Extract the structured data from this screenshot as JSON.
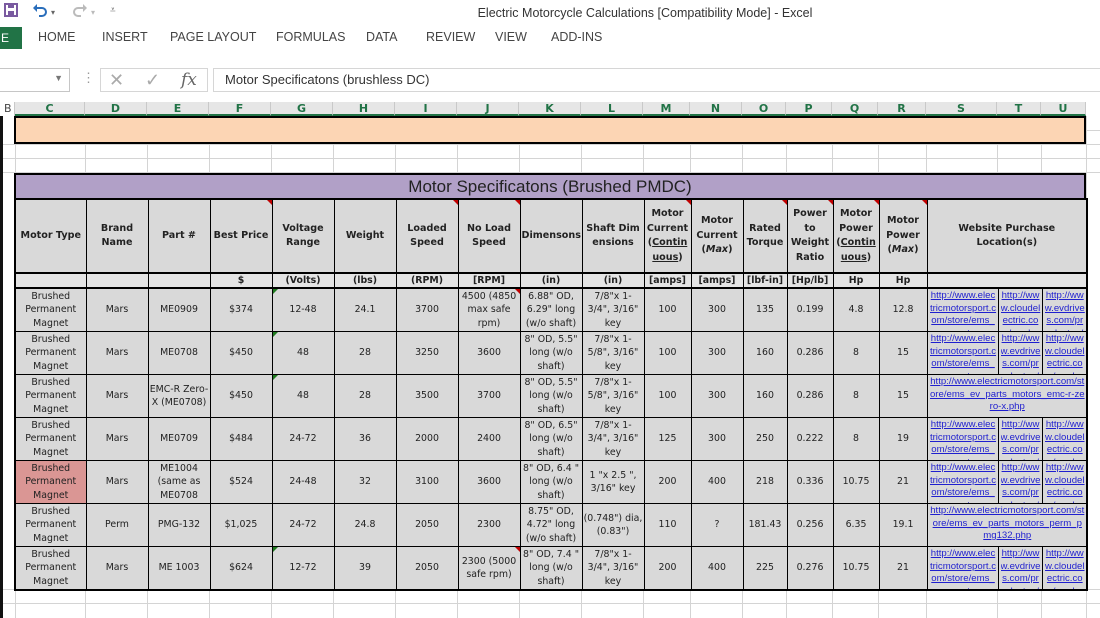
{
  "window": {
    "title": "Electric Motorcycle Calculations  [Compatibility Mode] - Excel",
    "qat": {
      "save_icon": "save-icon",
      "undo_icon": "undo-icon",
      "redo_icon": "redo-icon",
      "customize_icon": "customize-qat-icon"
    }
  },
  "ribbon": {
    "file_label": "E",
    "tabs": [
      "HOME",
      "INSERT",
      "PAGE LAYOUT",
      "FORMULAS",
      "DATA",
      "REVIEW",
      "VIEW",
      "ADD-INS"
    ]
  },
  "formula_bar": {
    "name_box": "",
    "cancel_icon": "✕",
    "enter_icon": "✓",
    "fx_label": "fx",
    "content": "Motor Specificatons (brushless DC)"
  },
  "column_headers": [
    "B",
    "C",
    "D",
    "E",
    "F",
    "G",
    "H",
    "I",
    "J",
    "K",
    "L",
    "M",
    "N",
    "O",
    "P",
    "Q",
    "R",
    "S",
    "T",
    "U"
  ],
  "sheet": {
    "section_title": "Motor Specificatons (Brushed PMDC)",
    "headers": [
      "Motor Type",
      "Brand Name",
      "Part #",
      "Best Price",
      "Voltage Range",
      "Weight",
      "Loaded Speed",
      "No Load Speed",
      "Dimensons",
      "Shaft Dimensions",
      "Motor Current (Continuous)",
      "Motor Current (Max)",
      "Rated Torque",
      "Power to Weight Ratio",
      "Motor Power (Continuous)",
      "Motor Power (Max)",
      "Website Purchase Location(s)"
    ],
    "header_parts": {
      "m_cur_cont_a": "Motor Current (",
      "m_cur_cont_b": "Continuous",
      "m_cur_cont_c": ")",
      "m_cur_max_a": "Motor Current (",
      "m_cur_max_b": "Max",
      "m_cur_max_c": ")",
      "m_pow_cont_a": "Motor Power (",
      "m_pow_cont_b": "Continuous",
      "m_pow_cont_c": ")",
      "m_pow_max_a": "Motor Power (",
      "m_pow_max_b": "Max",
      "m_pow_max_c": ")"
    },
    "units": [
      "",
      "",
      "",
      "$",
      "(Volts)",
      "(lbs)",
      "(RPM)",
      "[RPM]",
      "(in)",
      "(in)",
      "[amps]",
      "[amps]",
      "[lbf-in]",
      "[Hp/lb]",
      "Hp",
      "Hp",
      ""
    ],
    "rows": [
      {
        "type": "Brushed Permanent Magnet",
        "brand": "Mars",
        "part": "ME0909",
        "price": "$374",
        "voltage": "12-48",
        "weight": "24.1",
        "loaded": "3700",
        "noload": "4500 (4850 max safe rpm)",
        "dims": "6.88\" OD, 6.29\" long (w/o shaft)",
        "shaft": "7/8\"x 1-3/4\", 3/16\" key",
        "cur_cont": "100",
        "cur_max": "300",
        "torque": "135",
        "pwr": "0.199",
        "p_cont": "4.8",
        "p_max": "12.8",
        "links": [
          "http://www.electricmotorsport.com/store/ems_ev_parts_m",
          "http://www.cloudelectric.com/produc",
          "http://www.evdrives.com/product_p/"
        ],
        "highlight": false
      },
      {
        "type": "Brushed Permanent Magnet",
        "brand": "Mars",
        "part": "ME0708",
        "price": "$450",
        "voltage": "48",
        "weight": "28",
        "loaded": "3250",
        "noload": "3600",
        "dims": "8\" OD, 5.5\" long (w/o shaft)",
        "shaft": "7/8\"x 1-5/8\", 3/16\" key",
        "cur_cont": "100",
        "cur_max": "300",
        "torque": "160",
        "pwr": "0.286",
        "p_cont": "8",
        "p_max": "15",
        "links": [
          "http://www.electricmotorsport.com/store/ems_ev_parts_m",
          "http://www.evdrives.com/product_p/",
          "http://www.cloudelectric.com/produc"
        ],
        "highlight": false
      },
      {
        "type": "Brushed Permanent Magnet",
        "brand": "Mars",
        "part": "EMC-R Zero-X (ME0708)",
        "price": "$450",
        "voltage": "48",
        "weight": "28",
        "loaded": "3500",
        "noload": "3700",
        "dims": "8\" OD, 5.5\" long (w/o shaft)",
        "shaft": "7/8\"x 1-5/8\", 3/16\" key",
        "cur_cont": "100",
        "cur_max": "300",
        "torque": "160",
        "pwr": "0.286",
        "p_cont": "8",
        "p_max": "15",
        "links": [
          "http://www.electricmotorsport.com/store/ems_ev_parts_motors_emc-r-zero-x.php"
        ],
        "highlight": false
      },
      {
        "type": "Brushed Permanent Magnet",
        "brand": "Mars",
        "part": "ME0709",
        "price": "$484",
        "voltage": "24-72",
        "weight": "36",
        "loaded": "2000",
        "noload": "2400",
        "dims": "8\" OD, 6.5\" long (w/o shaft)",
        "shaft": "7/8\"x 1-3/4\", 3/16\" key",
        "cur_cont": "125",
        "cur_max": "300",
        "torque": "250",
        "pwr": "0.222",
        "p_cont": "8",
        "p_max": "19",
        "links": [
          "http://www.electricmotorsport.com/store/ems_ev_parts_m",
          "http://www.evdrives.com/product_p/",
          "http://www.cloudelectric.com/produc"
        ],
        "highlight": false
      },
      {
        "type": "Brushed Permanent Magnet",
        "brand": "Mars",
        "part": "ME1004 (same as ME0708",
        "price": "$524",
        "voltage": "24-48",
        "weight": "32",
        "loaded": "3100",
        "noload": "3600",
        "dims": "8\" OD, 6.4 \" long (w/o shaft)",
        "shaft": "1 \"x 2.5 \", 3/16\" key",
        "cur_cont": "200",
        "cur_max": "400",
        "torque": "218",
        "pwr": "0.336",
        "p_cont": "10.75",
        "p_max": "21",
        "links": [
          "http://www.electricmotorsport.com/store/ems_ev_parts_m",
          "http://www.evdrives.com/product_p/",
          "http://www.cloudelectric.com/produc"
        ],
        "highlight": true
      },
      {
        "type": "Brushed Permanent Magnet",
        "brand": "Perm",
        "part": "PMG-132",
        "price": "$1,025",
        "voltage": "24-72",
        "weight": "24.8",
        "loaded": "2050",
        "noload": "2300",
        "dims": "8.75\" OD, 4.72\" long (w/o shaft)",
        "shaft": "(0.748\") dia, (0.83\")",
        "cur_cont": "110",
        "cur_max": "?",
        "torque": "181.43",
        "pwr": "0.256",
        "p_cont": "6.35",
        "p_max": "19.1",
        "links": [
          "http://www.electricmotorsport.com/store/ems_ev_parts_motors_perm_pmg132.php"
        ],
        "highlight": false
      },
      {
        "type": "Brushed Permanent Magnet",
        "brand": "Mars",
        "part": "ME 1003",
        "price": "$624",
        "voltage": "12-72",
        "weight": "39",
        "loaded": "2050",
        "noload": "2300 (5000 safe rpm)",
        "dims": "8\" OD, 7.4 \" long (w/o shaft)",
        "shaft": "7/8\"x 1-3/4\", 3/16\" key",
        "cur_cont": "200",
        "cur_max": "400",
        "torque": "225",
        "pwr": "0.276",
        "p_cont": "10.75",
        "p_max": "21",
        "links": [
          "http://www.electricmotorsport.com/store/ems_ev_parts_m",
          "http://www.evdrives.com/product_p/",
          "http://www.cloudelectric.com/produc"
        ],
        "highlight": false
      }
    ]
  },
  "colors": {
    "excel_green": "#217346",
    "section_orange": "#fcd5b4",
    "title_purple": "#b1a0c7",
    "cell_gray": "#d9d9d9",
    "highlight_red": "#da9694",
    "link_blue": "#1f1fcf"
  }
}
